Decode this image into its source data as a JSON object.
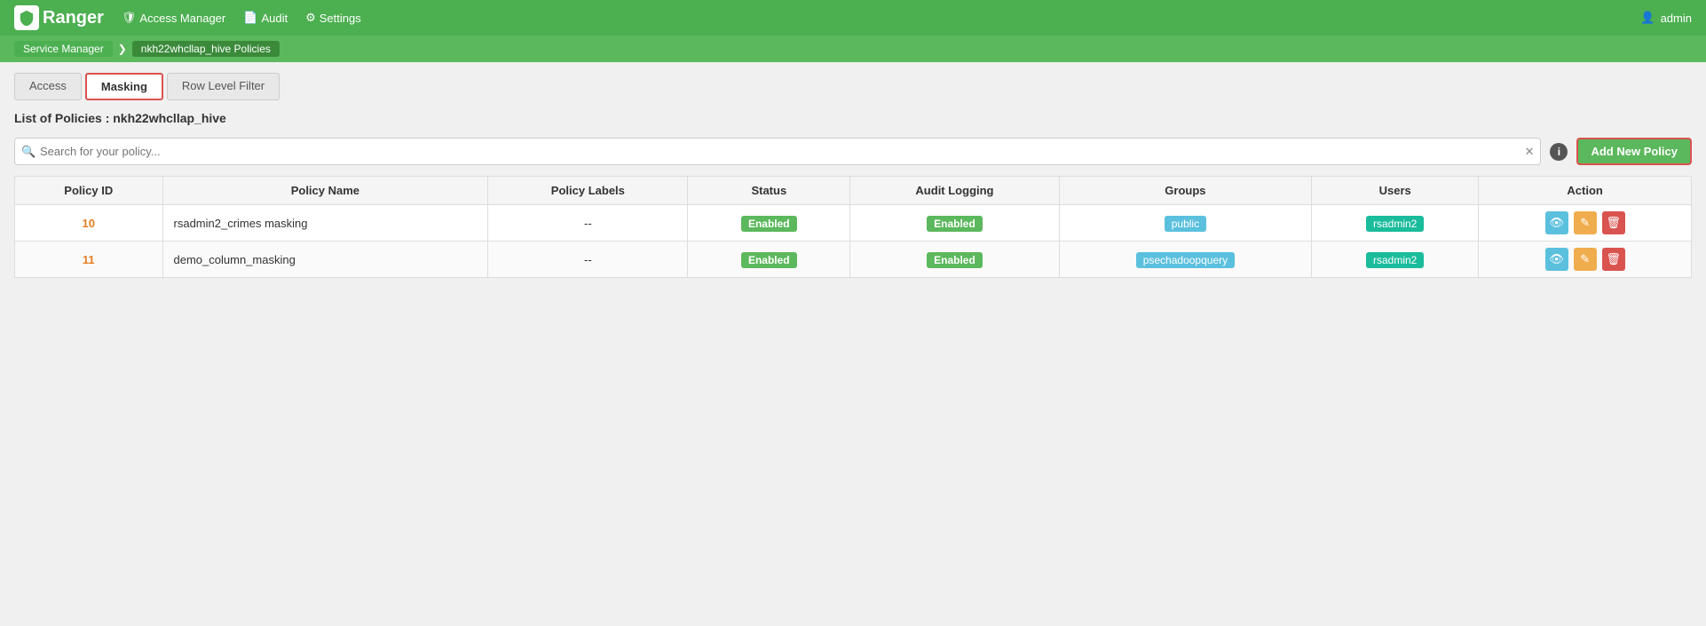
{
  "brand": {
    "name": "Ranger",
    "icon_char": "🛡"
  },
  "navbar": {
    "links": [
      {
        "id": "access-manager",
        "label": "Access Manager",
        "icon": "shield"
      },
      {
        "id": "audit",
        "label": "Audit",
        "icon": "file"
      },
      {
        "id": "settings",
        "label": "Settings",
        "icon": "gear"
      }
    ],
    "user": "admin"
  },
  "breadcrumb": {
    "items": [
      {
        "id": "service-manager",
        "label": "Service Manager"
      },
      {
        "id": "current-policy",
        "label": "nkh22whcllap_hive Policies"
      }
    ]
  },
  "tabs": [
    {
      "id": "access",
      "label": "Access"
    },
    {
      "id": "masking",
      "label": "Masking",
      "active": true
    },
    {
      "id": "row-level-filter",
      "label": "Row Level Filter"
    }
  ],
  "page": {
    "title": "List of Policies : nkh22whcllap_hive"
  },
  "search": {
    "placeholder": "Search for your policy...",
    "add_button_label": "Add New Policy"
  },
  "table": {
    "columns": [
      "Policy ID",
      "Policy Name",
      "Policy Labels",
      "Status",
      "Audit Logging",
      "Groups",
      "Users",
      "Action"
    ],
    "rows": [
      {
        "id": "10",
        "name": "rsadmin2_crimes masking",
        "labels": "--",
        "status": "Enabled",
        "audit_logging": "Enabled",
        "groups": "public",
        "users": "rsadmin2"
      },
      {
        "id": "11",
        "name": "demo_column_masking",
        "labels": "--",
        "status": "Enabled",
        "audit_logging": "Enabled",
        "groups": "psechadoopquery",
        "users": "rsadmin2"
      }
    ]
  },
  "icons": {
    "search": "🔍",
    "shield": "🛡",
    "file": "📄",
    "gear": "⚙",
    "admin": "👤",
    "info": "i",
    "view": "👁",
    "edit": "✎",
    "delete": "🗑",
    "clear": "✕",
    "arrow": "❯"
  }
}
